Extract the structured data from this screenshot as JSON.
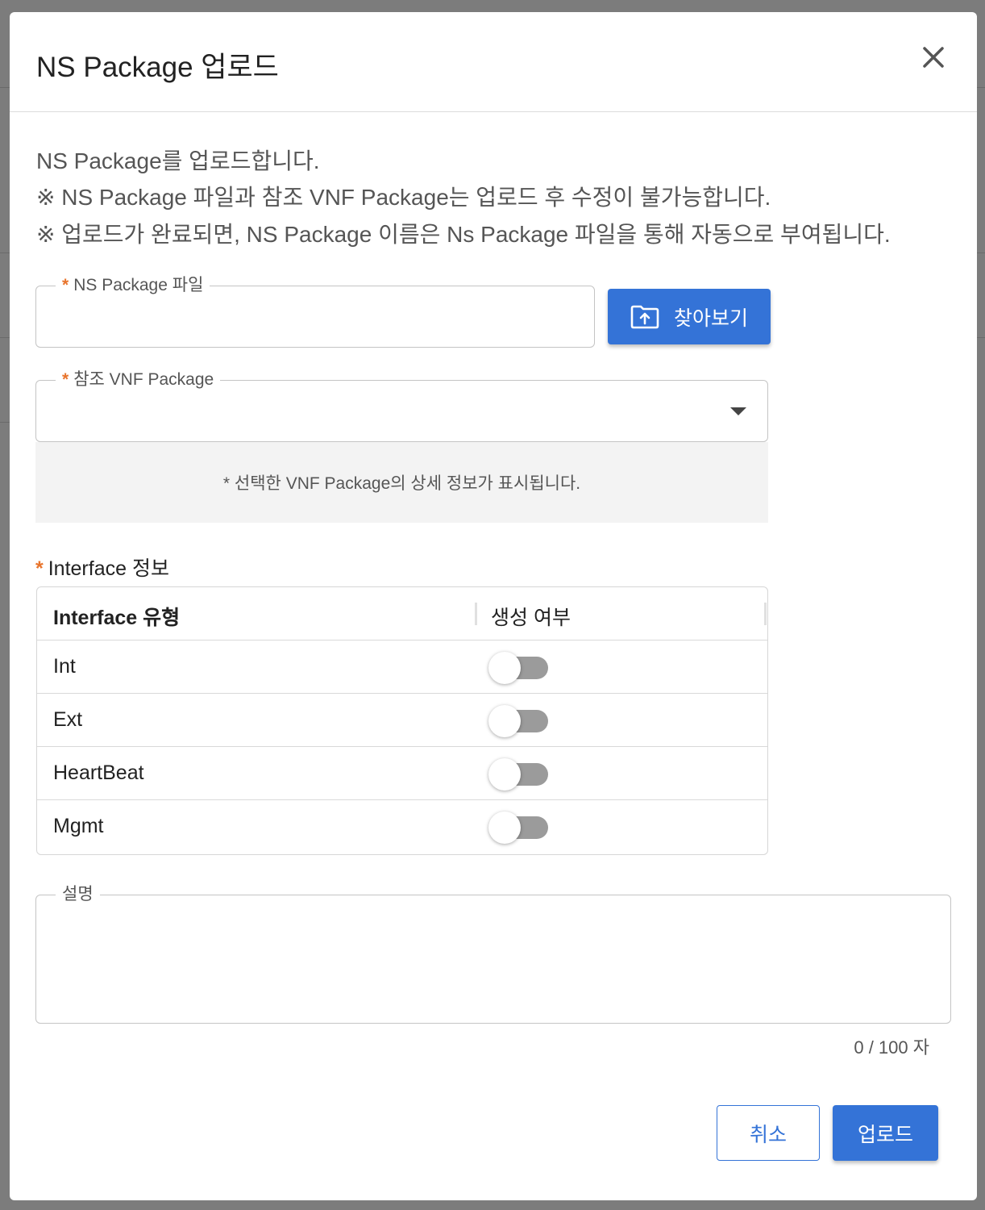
{
  "modal": {
    "title": "NS Package 업로드",
    "close_icon": "close-icon"
  },
  "description": {
    "line1": "NS Package를 업로드합니다.",
    "line2": "※ NS Package 파일과 참조 VNF Package는 업로드 후 수정이 불가능합니다.",
    "line3": "※ 업로드가 완료되면, NS Package 이름은 Ns Package 파일을 통해 자동으로 부여됩니다."
  },
  "file_field": {
    "required_mark": "*",
    "label": "NS Package 파일",
    "value": ""
  },
  "browse_button": {
    "label": "찾아보기",
    "icon": "folder-upload-icon"
  },
  "vnf_field": {
    "required_mark": "*",
    "label": "참조 VNF Package",
    "value": ""
  },
  "vnf_detail": {
    "text": "* 선택한 VNF Package의 상세 정보가 표시됩니다."
  },
  "interface": {
    "required_mark": "*",
    "label": "Interface 정보",
    "columns": [
      "Interface 유형",
      "생성 여부"
    ],
    "rows": [
      {
        "name": "Int",
        "enabled": false
      },
      {
        "name": "Ext",
        "enabled": false
      },
      {
        "name": "HeartBeat",
        "enabled": false
      },
      {
        "name": "Mgmt",
        "enabled": false
      }
    ]
  },
  "description_field": {
    "label": "설명",
    "value": "",
    "char_count": "0 / 100 자"
  },
  "footer": {
    "cancel_label": "취소",
    "upload_label": "업로드"
  },
  "colors": {
    "primary": "#3473d7",
    "required": "#e8742c",
    "toggle_off": "#9b9b9b"
  }
}
